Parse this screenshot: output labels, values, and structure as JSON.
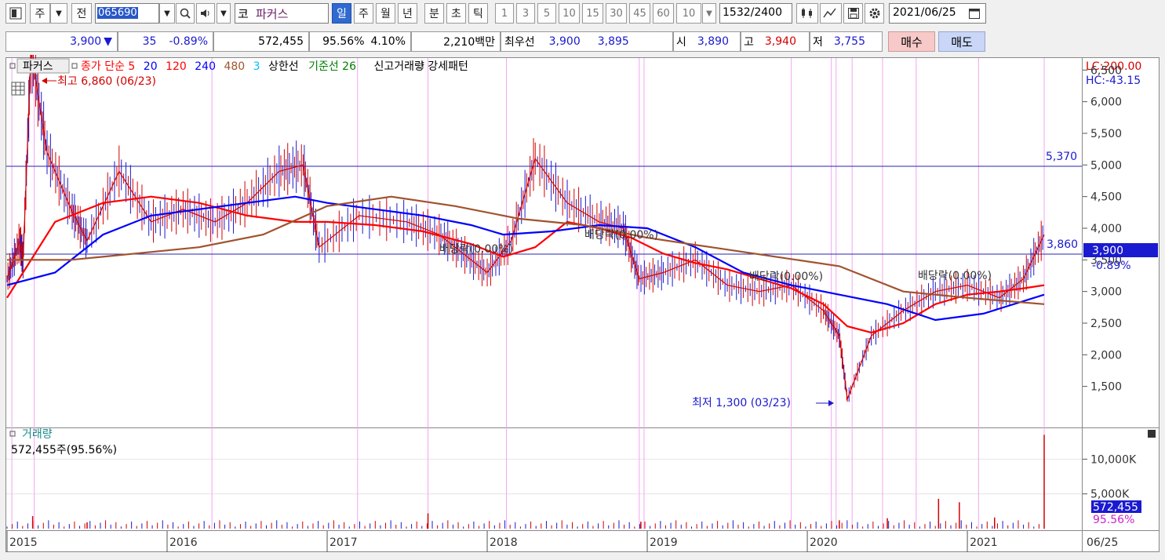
{
  "toolbar": {
    "type_label": "주",
    "prev_label": "전",
    "stock_code": "065690",
    "market_label": "코",
    "stock_name": "파커스",
    "periods": [
      "일",
      "주",
      "월",
      "년",
      "분",
      "초",
      "틱"
    ],
    "selected_period": "일",
    "intervals": [
      "1",
      "3",
      "5",
      "10",
      "15",
      "30",
      "45",
      "60"
    ],
    "interval_value": "10",
    "count": "1532",
    "count_total": "/2400",
    "date": "2021/06/25"
  },
  "quote": {
    "price": "3,900",
    "change": "35",
    "change_pct": "-0.89%",
    "volume": "572,455",
    "volume_ratio": "95.56%",
    "turnover_rate": "4.10%",
    "amount": "2,210백만",
    "best_ask_label": "최우선",
    "best_ask": "3,900",
    "best_bid": "3,895",
    "open_label": "시",
    "open": "3,890",
    "high_label": "고",
    "high": "3,940",
    "low_label": "저",
    "low": "3,755",
    "buy_label": "매수",
    "sell_label": "매도"
  },
  "legend": {
    "name": "파커스",
    "items": [
      {
        "text": "종가 단순 5",
        "color": "#ff0000"
      },
      {
        "text": "20",
        "color": "#0000ff"
      },
      {
        "text": "120",
        "color": "#ff0000"
      },
      {
        "text": "240",
        "color": "#0000ff"
      },
      {
        "text": "480",
        "color": "#a0522d"
      },
      {
        "text": "3",
        "color": "#00c0ff"
      },
      {
        "text": "상한선",
        "color": "#000000"
      },
      {
        "text": "기준선 26",
        "color": "#008000"
      },
      {
        "text": "신고거래량 강세패턴",
        "color": "#000000"
      }
    ],
    "lc": "LC:200.00",
    "hc": "HC:-43.15"
  },
  "annotations": {
    "high_note": "최고 6,860 (06/23)",
    "low_note": "최저 1,300 (03/23)",
    "dividend1": "배당락(0.00%)",
    "dividend2": "배당락(0.00%)",
    "dividend3": "배당락(0.00%)",
    "dividend4": "배당락(0.00%)",
    "hline_upper": "5,370",
    "hline_lower": "3,860",
    "current_price": "3,900",
    "current_change": "-0.89%"
  },
  "volume_panel": {
    "title": "거래량",
    "value": "572,455주(95.56%)",
    "current": "572,455",
    "ratio": "95.56%"
  },
  "chart_data": {
    "type": "line",
    "title": "",
    "xlabel": "",
    "ylabel": "",
    "ylim": [
      1000,
      7000
    ],
    "y_ticks": [
      "6,500",
      "6,000",
      "5,500",
      "5,000",
      "4,500",
      "4,000",
      "3,500",
      "3,000",
      "2,500",
      "2,000",
      "1,500"
    ],
    "x_ticks": [
      "2015",
      "2016",
      "2017",
      "2018",
      "2019",
      "2020",
      "2021",
      "06/25"
    ],
    "volume_ticks": [
      "10,000K",
      "5,000K"
    ],
    "series": [
      {
        "name": "종가",
        "color": "#d40000",
        "x": [
          2015.0,
          2015.08,
          2015.1,
          2015.15,
          2015.25,
          2015.4,
          2015.5,
          2015.7,
          2015.9,
          2016.1,
          2016.3,
          2016.5,
          2016.7,
          2016.85,
          2016.95,
          2017.2,
          2017.5,
          2017.7,
          2017.85,
          2018.0,
          2018.15,
          2018.3,
          2018.5,
          2018.7,
          2018.85,
          2018.95,
          2019.1,
          2019.3,
          2019.5,
          2019.7,
          2019.9,
          2020.1,
          2020.2,
          2020.25,
          2020.4,
          2020.6,
          2020.8,
          2021.0,
          2021.2,
          2021.35,
          2021.48
        ],
        "values": [
          3200,
          3800,
          3500,
          6800,
          5200,
          4300,
          3800,
          4900,
          4100,
          4300,
          4100,
          4400,
          4900,
          5000,
          3700,
          4200,
          4100,
          3900,
          3600,
          3300,
          3800,
          5100,
          4400,
          4100,
          4000,
          3200,
          3300,
          3500,
          3100,
          3000,
          3100,
          2700,
          2300,
          1300,
          2300,
          2700,
          3000,
          3100,
          2900,
          3200,
          3900
        ]
      },
      {
        "name": "5",
        "color": "#ff0000",
        "x": [
          2015.0,
          2015.1,
          2015.3,
          2015.6,
          2015.9,
          2016.2,
          2016.5,
          2016.8,
          2017.0,
          2017.3,
          2017.6,
          2017.9,
          2018.1,
          2018.3,
          2018.5,
          2018.7,
          2018.9,
          2019.1,
          2019.3,
          2019.5,
          2019.7,
          2019.9,
          2020.1,
          2020.25,
          2020.4,
          2020.6,
          2020.8,
          2021.0,
          2021.2,
          2021.35,
          2021.48
        ],
        "values": [
          2900,
          3300,
          4100,
          4400,
          4500,
          4400,
          4200,
          4100,
          4100,
          4050,
          3950,
          3750,
          3550,
          3700,
          4100,
          4000,
          3850,
          3600,
          3450,
          3350,
          3200,
          3050,
          2800,
          2450,
          2350,
          2500,
          2800,
          2950,
          3000,
          3050,
          3100
        ]
      },
      {
        "name": "240",
        "color": "#0000ff",
        "x": [
          2015.0,
          2015.3,
          2015.6,
          2015.9,
          2016.2,
          2016.5,
          2016.8,
          2017.0,
          2017.3,
          2017.6,
          2017.9,
          2018.1,
          2018.4,
          2018.7,
          2019.0,
          2019.3,
          2019.6,
          2019.9,
          2020.2,
          2020.5,
          2020.8,
          2021.1,
          2021.48
        ],
        "values": [
          3100,
          3300,
          3900,
          4200,
          4300,
          4400,
          4500,
          4400,
          4300,
          4200,
          4050,
          3900,
          3950,
          4050,
          4000,
          3700,
          3300,
          3100,
          2950,
          2800,
          2550,
          2650,
          2950
        ]
      },
      {
        "name": "480",
        "color": "#a0522d",
        "x": [
          2015.0,
          2015.4,
          2015.8,
          2016.2,
          2016.6,
          2017.0,
          2017.4,
          2017.8,
          2018.2,
          2018.6,
          2019.0,
          2019.4,
          2019.8,
          2020.2,
          2020.6,
          2021.0,
          2021.48
        ],
        "values": [
          3500,
          3500,
          3600,
          3700,
          3900,
          4350,
          4500,
          4350,
          4150,
          4050,
          3850,
          3700,
          3550,
          3400,
          3000,
          2900,
          2800
        ]
      }
    ]
  }
}
